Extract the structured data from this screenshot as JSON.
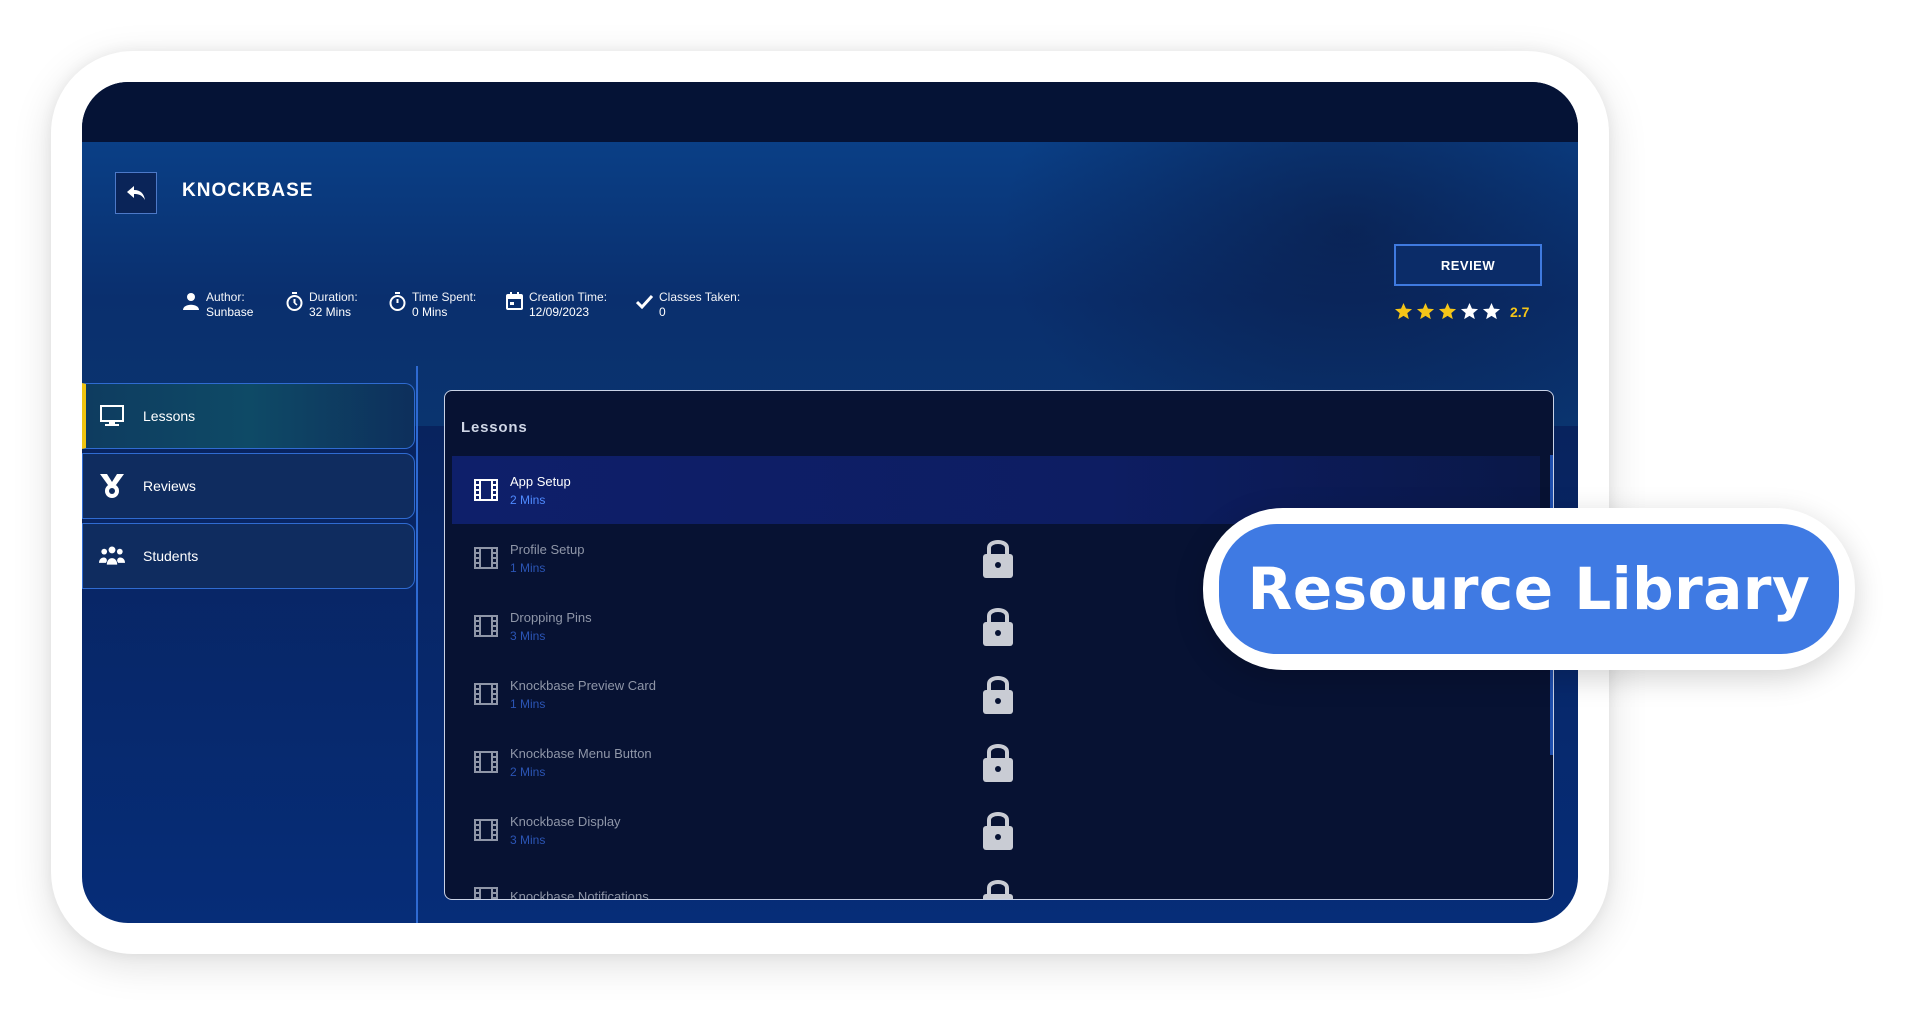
{
  "course": {
    "title": "KNOCKBASE",
    "meta": {
      "author_label": "Author:",
      "author_value": "Sunbase",
      "duration_label": "Duration:",
      "duration_value": "32 Mins",
      "time_spent_label": "Time Spent:",
      "time_spent_value": "0 Mins",
      "creation_label": "Creation Time:",
      "creation_value": "12/09/2023",
      "classes_label": "Classes Taken:",
      "classes_value": "0"
    },
    "review_label": "REVIEW",
    "rating": {
      "value": "2.7",
      "filled_stars": 3,
      "total_stars": 5,
      "filled_color": "#f5c518",
      "empty_color": "#ffffff"
    }
  },
  "sidebar": {
    "items": [
      {
        "label": "Lessons",
        "icon": "monitor-icon",
        "active": true
      },
      {
        "label": "Reviews",
        "icon": "medal-icon",
        "active": false
      },
      {
        "label": "Students",
        "icon": "group-icon",
        "active": false
      }
    ]
  },
  "lessons_panel": {
    "title": "Lessons",
    "items": [
      {
        "title": "App Setup",
        "duration": "2 Mins",
        "locked": false
      },
      {
        "title": "Profile Setup",
        "duration": "1 Mins",
        "locked": true
      },
      {
        "title": "Dropping Pins",
        "duration": "3 Mins",
        "locked": true
      },
      {
        "title": "Knockbase Preview Card",
        "duration": "1 Mins",
        "locked": true
      },
      {
        "title": " Knockbase Menu Button",
        "duration": "2 Mins",
        "locked": true
      },
      {
        "title": "Knockbase Display",
        "duration": "3 Mins",
        "locked": true
      },
      {
        "title": "Knockbase Notifications",
        "duration": "",
        "locked": true
      }
    ]
  },
  "badge": {
    "label": "Resource Library",
    "color": "#3f7ae3"
  },
  "colors": {
    "accent": "#3f7ae0",
    "active_indicator": "#f1c40f"
  }
}
